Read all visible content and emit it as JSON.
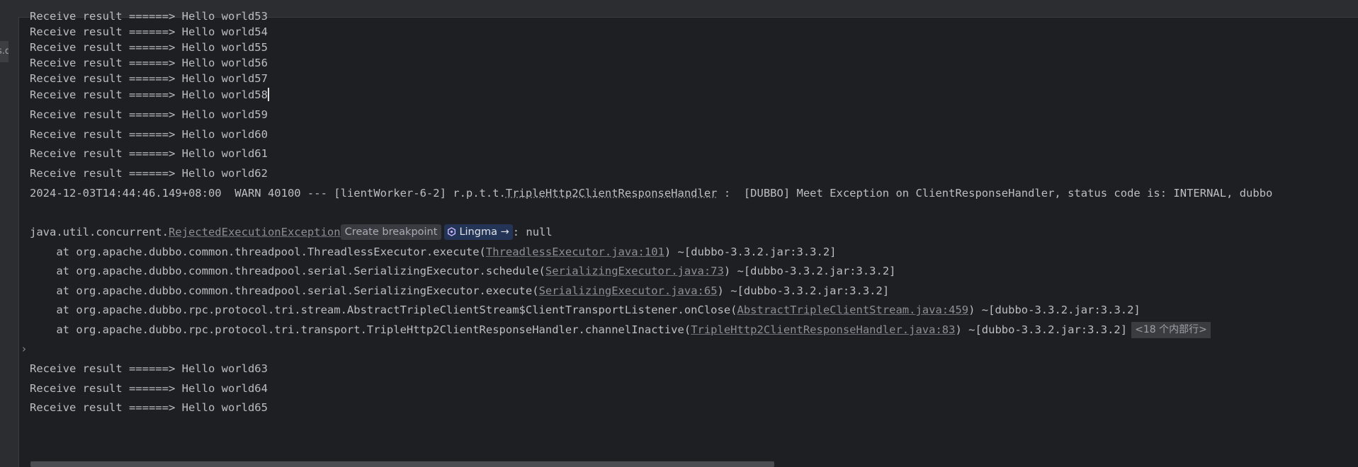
{
  "gutter": {
    "tab_text": "s.qu"
  },
  "console": {
    "lines_top": [
      "Receive result ======> Hello world53",
      "Receive result ======> Hello world54",
      "Receive result ======> Hello world55",
      "Receive result ======> Hello world56",
      "Receive result ======> Hello world57",
      "Receive result ======> Hello world58",
      "Receive result ======> Hello world59",
      "Receive result ======> Hello world60",
      "Receive result ======> Hello world61",
      "Receive result ======> Hello world62"
    ],
    "warn": {
      "prefix": "2024-12-03T14:44:46.149+08:00  WARN 40100 --- [lientWorker-6-2] r.p.t.t.",
      "class_link": "TripleHttp2ClientResponseHandler",
      "message": " :  [DUBBO] Meet Exception on ClientResponseHandler, status code is: INTERNAL, dubbo"
    },
    "exception": {
      "package": "java.util.concurrent.",
      "class_link": "RejectedExecutionException",
      "breakpoint_hint": "Create breakpoint",
      "lingma_label": "Lingma",
      "lingma_arrow": "→",
      "suffix": ": null"
    },
    "stack": [
      {
        "method": "    at org.apache.dubbo.common.threadpool.ThreadlessExecutor.execute(",
        "source": "ThreadlessExecutor.java:101",
        "jar": ") ~[dubbo-3.3.2.jar:3.3.2]"
      },
      {
        "method": "    at org.apache.dubbo.common.threadpool.serial.SerializingExecutor.schedule(",
        "source": "SerializingExecutor.java:73",
        "jar": ") ~[dubbo-3.3.2.jar:3.3.2]"
      },
      {
        "method": "    at org.apache.dubbo.common.threadpool.serial.SerializingExecutor.execute(",
        "source": "SerializingExecutor.java:65",
        "jar": ") ~[dubbo-3.3.2.jar:3.3.2]"
      },
      {
        "method": "    at org.apache.dubbo.rpc.protocol.tri.stream.AbstractTripleClientStream$ClientTransportListener.onClose(",
        "source": "AbstractTripleClientStream.java:459",
        "jar": ") ~[dubbo-3.3.2.jar:3.3.2]"
      },
      {
        "method": "    at org.apache.dubbo.rpc.protocol.tri.transport.TripleHttp2ClientResponseHandler.channelInactive(",
        "source": "TripleHttp2ClientResponseHandler.java:83",
        "jar": ") ~[dubbo-3.3.2.jar:3.3.2]"
      }
    ],
    "folded_frames": "<18 个内部行>",
    "expand_chevron": "›",
    "lines_bottom": [
      "Receive result ======> Hello world63",
      "Receive result ======> Hello world64",
      "Receive result ======> Hello world65"
    ]
  },
  "colors": {
    "background": "#1e1f22",
    "text": "#bcbec4",
    "link": "#8c8f96",
    "lingma_badge": "#233456"
  }
}
